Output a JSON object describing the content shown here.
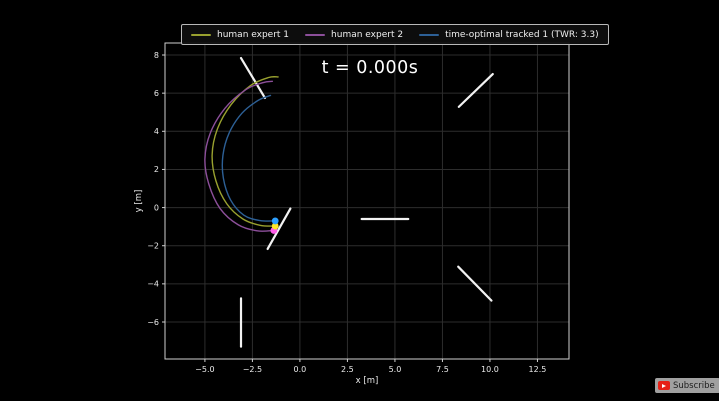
{
  "page": {
    "background": "#000000"
  },
  "video": {
    "subscribe": {
      "label": "Subscribe",
      "icon": "youtube-play-icon"
    }
  },
  "chart_data": {
    "type": "line",
    "title": "t = 0.000s",
    "xlabel": "x [m]",
    "ylabel": "y [m]",
    "xlim": [
      -7.1,
      14.16
    ],
    "ylim": [
      -7.94,
      8.63
    ],
    "xticks": [
      -5.0,
      -2.5,
      0.0,
      2.5,
      5.0,
      7.5,
      10.0,
      12.5
    ],
    "xtick_labels": [
      "−5.0",
      "−2.5",
      "0.0",
      "2.5",
      "5.0",
      "7.5",
      "10.0",
      "12.5"
    ],
    "yticks": [
      8,
      6,
      4,
      2,
      0,
      -2,
      -4,
      -6
    ],
    "ytick_labels": [
      "8",
      "6",
      "4",
      "2",
      "0",
      "−2",
      "−4",
      "−6"
    ],
    "grid": true,
    "legend_position": "top-outside",
    "colors": {
      "background": "#000000",
      "grid": "#2d2d2d",
      "spine": "#cfcfcf",
      "text": "#eaeaea",
      "gate": "#f2f2f2"
    },
    "series": [
      {
        "name": "human expert 1",
        "color": "#99a12f",
        "points": [
          [
            -1.3,
            -0.97
          ],
          [
            -2.1,
            -0.93
          ],
          [
            -3.0,
            -0.6
          ],
          [
            -3.85,
            0.2
          ],
          [
            -4.42,
            1.4
          ],
          [
            -4.62,
            2.75
          ],
          [
            -4.35,
            4.1
          ],
          [
            -3.62,
            5.4
          ],
          [
            -2.6,
            6.4
          ],
          [
            -1.65,
            6.82
          ],
          [
            -1.15,
            6.85
          ]
        ]
      },
      {
        "name": "human expert 2",
        "color": "#8c4f9a",
        "points": [
          [
            -1.37,
            -1.2
          ],
          [
            -2.25,
            -1.22
          ],
          [
            -3.25,
            -0.9
          ],
          [
            -4.2,
            -0.05
          ],
          [
            -4.8,
            1.25
          ],
          [
            -5.0,
            2.55
          ],
          [
            -4.72,
            3.9
          ],
          [
            -3.95,
            5.2
          ],
          [
            -2.85,
            6.18
          ],
          [
            -1.95,
            6.55
          ],
          [
            -1.45,
            6.62
          ]
        ]
      },
      {
        "name": "time-optimal tracked 1 (TWR: 3.3)",
        "color": "#2d6096",
        "points": [
          [
            -1.3,
            -0.7
          ],
          [
            -2.1,
            -0.68
          ],
          [
            -2.95,
            -0.4
          ],
          [
            -3.65,
            0.4
          ],
          [
            -4.03,
            1.55
          ],
          [
            -4.05,
            2.75
          ],
          [
            -3.72,
            3.92
          ],
          [
            -3.05,
            4.95
          ],
          [
            -2.2,
            5.62
          ],
          [
            -1.55,
            5.88
          ]
        ]
      }
    ],
    "start_markers": [
      {
        "series": "human expert 2",
        "x": -1.37,
        "y": -1.2,
        "color": "#ff5ce8"
      },
      {
        "series": "human expert 1",
        "x": -1.3,
        "y": -0.97,
        "color": "#ffe928"
      },
      {
        "series": "time-optimal tracked 1 (TWR: 3.3)",
        "x": -1.3,
        "y": -0.7,
        "color": "#2da0ff"
      }
    ],
    "gates": [
      {
        "x1": -3.1,
        "y1": 7.84,
        "x2": -1.84,
        "y2": 5.75
      },
      {
        "x1": 8.36,
        "y1": 5.28,
        "x2": 10.15,
        "y2": 7.0
      },
      {
        "x1": 3.25,
        "y1": -0.6,
        "x2": 5.7,
        "y2": -0.6
      },
      {
        "x1": 8.33,
        "y1": -3.1,
        "x2": 10.08,
        "y2": -4.88
      },
      {
        "x1": -1.7,
        "y1": -2.17,
        "x2": -0.5,
        "y2": -0.05
      },
      {
        "x1": -3.1,
        "y1": -4.76,
        "x2": -3.1,
        "y2": -7.29
      }
    ]
  }
}
